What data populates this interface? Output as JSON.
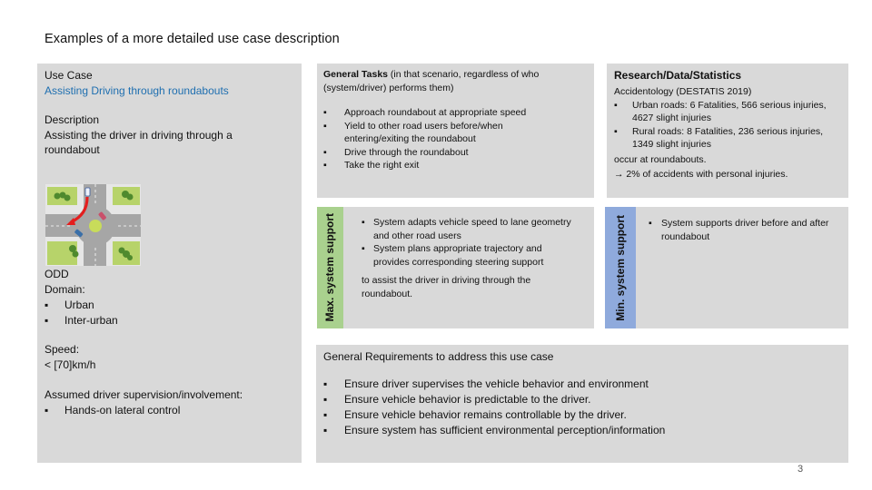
{
  "slide": {
    "title": "Examples of a more detailed use case description",
    "page_number": "3"
  },
  "use_case": {
    "label": "Use Case",
    "name": "Assisting Driving through roundabouts",
    "description_label": "Description",
    "description": "Assisting the driver in driving through a roundabout",
    "image_alt": "roundabout-diagram"
  },
  "odd": {
    "label": "ODD",
    "domain_label": "Domain:",
    "domain_items": [
      "Urban",
      "Inter-urban"
    ],
    "speed_label": "Speed:",
    "speed_value": "< [70]km/h",
    "supervision_label": "Assumed driver supervision/involvement:",
    "supervision_items": [
      "Hands-on lateral control"
    ]
  },
  "general_tasks": {
    "heading_bold": "General Tasks",
    "heading_rest": " (in that scenario, regardless of who (system/driver) performs them)",
    "items": [
      "Approach roundabout at appropriate speed",
      "Yield to other road users before/when entering/exiting the roundabout",
      "Drive through the roundabout",
      "Take the right exit"
    ]
  },
  "research": {
    "heading": "Research/Data/Statistics",
    "source": "Accidentology (DESTATIS 2019)",
    "items": [
      "Urban roads: 6 Fatalities, 566 serious injuries, 4627 slight injuries",
      "Rural roads: 8 Fatalities, 236 serious injuries, 1349 slight injuries"
    ],
    "footer": "occur at roundabouts.",
    "conclusion": "→ 2% of accidents with personal injuries."
  },
  "max_support": {
    "label": "Max. system support",
    "items": [
      "System adapts vehicle speed to lane geometry and other road users",
      "System plans appropriate trajectory and provides corresponding steering support"
    ],
    "after": "to assist the driver in driving through the roundabout."
  },
  "min_support": {
    "label": "Min. system support",
    "items": [
      "System supports driver before and after roundabout"
    ]
  },
  "requirements": {
    "heading": "General Requirements to address this use case",
    "items": [
      "Ensure driver supervises the vehicle behavior and environment",
      "Ensure vehicle behavior is predictable to the driver.",
      "Ensure vehicle behavior remains controllable by the driver.",
      "Ensure system has sufficient environmental perception/information"
    ]
  },
  "colors": {
    "accent": "#1f6fb0",
    "panel": "#d9d9d9",
    "max_strip": "#a9d18e",
    "min_strip": "#8faadc"
  },
  "bullet": "▪"
}
